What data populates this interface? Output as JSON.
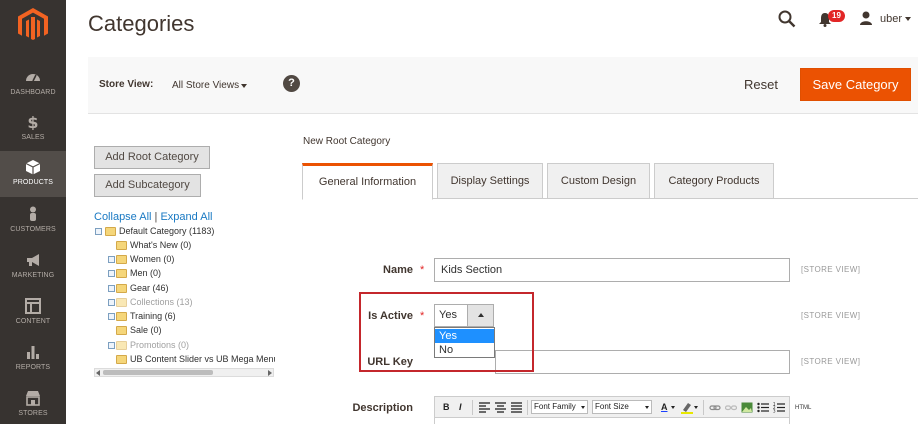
{
  "sidebar": {
    "items": [
      {
        "label": "DASHBOARD",
        "icon": "dashboard-icon"
      },
      {
        "label": "SALES",
        "icon": "dollar-icon"
      },
      {
        "label": "PRODUCTS",
        "icon": "box-icon",
        "active": true
      },
      {
        "label": "CUSTOMERS",
        "icon": "person-icon"
      },
      {
        "label": "MARKETING",
        "icon": "megaphone-icon"
      },
      {
        "label": "CONTENT",
        "icon": "layout-icon"
      },
      {
        "label": "REPORTS",
        "icon": "bar-chart-icon"
      },
      {
        "label": "STORES",
        "icon": "store-icon"
      }
    ]
  },
  "header": {
    "title": "Categories",
    "notification_count": "19",
    "user_name": "uber"
  },
  "store_bar": {
    "label": "Store View:",
    "value": "All Store Views",
    "help": "?",
    "reset_label": "Reset",
    "save_label": "Save Category"
  },
  "tree_panel": {
    "add_root_label": "Add Root Category",
    "add_sub_label": "Add Subcategory",
    "collapse_all": "Collapse All",
    "separator": "|",
    "expand_all": "Expand All",
    "nodes": [
      {
        "text": "Default Category (1183)"
      },
      {
        "text": "What's New (0)"
      },
      {
        "text": "Women (0)"
      },
      {
        "text": "Men (0)"
      },
      {
        "text": "Gear (46)"
      },
      {
        "text": "Collections (13)"
      },
      {
        "text": "Training (6)"
      },
      {
        "text": "Sale (0)"
      },
      {
        "text": "Promotions (0)"
      },
      {
        "text": "UB Content Slider vs UB Mega Menu"
      }
    ]
  },
  "form": {
    "section_title": "New Root Category",
    "tabs": [
      {
        "label": "General Information",
        "active": true
      },
      {
        "label": "Display Settings"
      },
      {
        "label": "Custom Design"
      },
      {
        "label": "Category Products"
      }
    ],
    "required_mark": "*",
    "scope_label": "[STORE VIEW]",
    "name_label": "Name",
    "name_value": "Kids Section",
    "is_active_label": "Is Active",
    "is_active_value": "Yes",
    "is_active_options": [
      "Yes",
      "No"
    ],
    "url_key_label": "URL Key",
    "url_key_value": "",
    "description_label": "Description",
    "editor": {
      "bold": "B",
      "italic": "I",
      "font_family": "Font Family",
      "font_size": "Font Size",
      "text_color": "A",
      "html_label": "HTML"
    }
  },
  "colors": {
    "accent": "#eb5202",
    "sidebar_bg": "#373330",
    "highlight_border": "#c4272c",
    "link": "#1979c3"
  }
}
